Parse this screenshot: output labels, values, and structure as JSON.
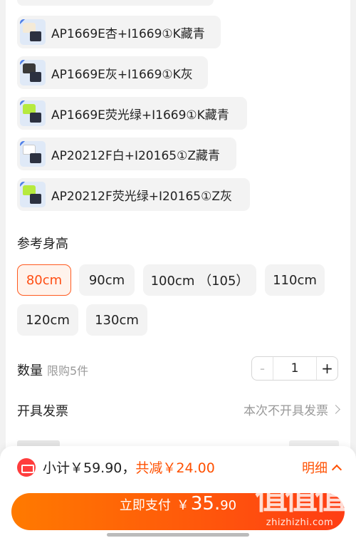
{
  "colors": {
    "accent": "#ff5000",
    "chip_bg": "#f3f3f3",
    "selected_border": "#ff5a1f"
  },
  "options": [
    {
      "label": "AP1669E杏+I1669①K藏青",
      "shirt_color": "#f4ead7"
    },
    {
      "label": "AP1669E灰+I1669①K灰",
      "shirt_color": "#3a3a3a"
    },
    {
      "label": "AP1669E荧光绿+I1669①K藏青",
      "shirt_color": "#b6ea3f"
    },
    {
      "label": "AP20212F白+I20165①Z藏青",
      "shirt_color": "#ffffff"
    },
    {
      "label": "AP20212F荧光绿+I20165①Z灰",
      "shirt_color": "#b6ea3f"
    }
  ],
  "height_section": {
    "title": "参考身高"
  },
  "sizes": [
    {
      "label": "80cm",
      "selected": true
    },
    {
      "label": "90cm",
      "selected": false
    },
    {
      "label": "100cm （105）",
      "selected": false
    },
    {
      "label": "110cm",
      "selected": false
    },
    {
      "label": "120cm",
      "selected": false
    },
    {
      "label": "130cm",
      "selected": false
    }
  ],
  "quantity": {
    "label": "数量",
    "limit": "限购5件",
    "value": "1",
    "minus": "-",
    "plus": "+"
  },
  "invoice": {
    "label": "开具发票",
    "value": "本次不开具发票"
  },
  "footer": {
    "subtotal": "小计￥59.90，",
    "discount": "共减￥24.00",
    "detail": "明细",
    "pay_label": "立即支付",
    "pay_currency": "￥",
    "pay_int": "35.",
    "pay_dec": "90"
  },
  "watermark": {
    "big": "值值值",
    "small": "zhizhizhi.com"
  }
}
